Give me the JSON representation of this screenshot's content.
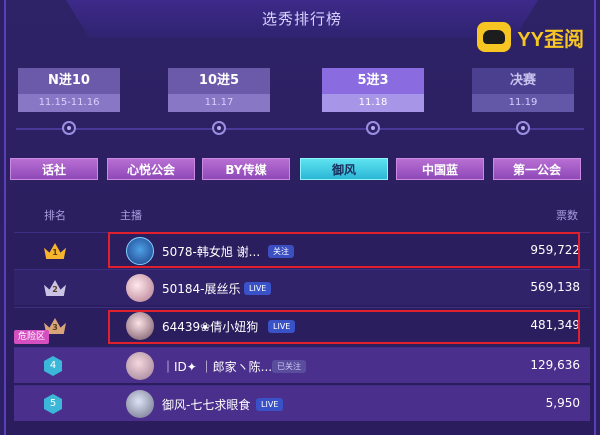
{
  "header": {
    "title": "选秀排行榜"
  },
  "logo": {
    "text": "YY歪阅",
    "icon": "yy-mascot-icon"
  },
  "stages": [
    {
      "name": "N进10",
      "date": "11.15-11.16",
      "state": "done"
    },
    {
      "name": "10进5",
      "date": "11.17",
      "state": "done"
    },
    {
      "name": "5进3",
      "date": "11.18",
      "state": "active"
    },
    {
      "name": "决赛",
      "date": "11.19",
      "state": "upcoming"
    }
  ],
  "tabs": [
    "话社",
    "心悦公会",
    "BY传媒",
    "御风",
    "中国蓝",
    "第一公会"
  ],
  "active_tab": "御风",
  "table": {
    "col_rank": "排名",
    "col_anchor": "主播",
    "col_votes": "票数",
    "danger_label": "危险区",
    "rows": [
      {
        "rank": "1",
        "anchor": "5078-韩女旭 谢...",
        "badge": "关注",
        "badge_type": "follow",
        "votes": "959,722"
      },
      {
        "rank": "2",
        "anchor": "50184-展丝乐",
        "badge": "LIVE",
        "badge_type": "live",
        "votes": "569,138"
      },
      {
        "rank": "3",
        "anchor": "64439❀倩小妞狗",
        "badge": "LIVE",
        "badge_type": "live",
        "votes": "481,349"
      },
      {
        "rank": "4",
        "anchor": "｜ID✦ ｜郎家ヽ陈...",
        "badge": "已关注",
        "badge_type": "offline",
        "votes": "129,636"
      },
      {
        "rank": "5",
        "anchor": "御风-七七求眼食",
        "badge": "LIVE",
        "badge_type": "live",
        "votes": "5,950"
      }
    ]
  },
  "colors": {
    "accent": "#2bb6d6",
    "highlight": "#e0202c",
    "background": "#2c1f63"
  }
}
